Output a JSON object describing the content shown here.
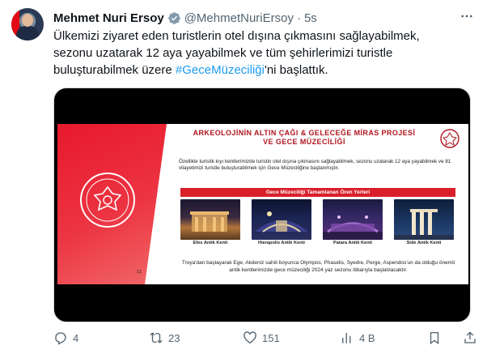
{
  "tweet": {
    "author_name": "Mehmet Nuri Ersoy",
    "handle": "@MehmetNuriErsoy",
    "separator": "·",
    "time": "5s",
    "more_icon": "more-horizontal-icon",
    "text_lines": [
      "Ülkemizi ziyaret eden turistlerin otel dışına çıkmasını sağlayabilmek,",
      "sezonu uzatarak 12 aya yayabilmek ve tüm şehirlerimizi turistle",
      "buluşturabilmek üzere "
    ],
    "hashtag": "#GeceMüzeciliği",
    "text_tail": "'ni başlattık."
  },
  "slide": {
    "title_line1": "ARKEOLOJİNİN ALTIN ÇAĞI & GELECEĞE MİRAS PROJESİ",
    "title_line2": "VE GECE MÜZECİLİĞİ",
    "paragraph": "Özellikle turistik kıyı kentlerimizde turistin otel dışına çıkmasını sağlayabilmek, sezonu uzatarak 12 aya yayabilmek ve 81 vilayetimizi turistle buluşturabilmek için Gece Müzeciliğine başlanmıştır.",
    "bar_label": "Gece Müzeciliği Tamamlanan Ören Yerleri",
    "sites": [
      {
        "caption": "Efes Antik Kenti"
      },
      {
        "caption": "Hierapolis Antik Kenti"
      },
      {
        "caption": "Patara Antik Kenti"
      },
      {
        "caption": "Side Antik Kenti"
      }
    ],
    "footer": "Troya'dan başlayarak Ege, Akdeniz sahili boyunca Olympos, Phaselis, Syedre, Perge, Aspendos'un da olduğu önemli antik kentlerimizde gece müzeciliği 2024 yaz sezonu itibarıyla başlatılacaktır.",
    "page_number": "11"
  },
  "actions": {
    "reply_count": "4",
    "repost_count": "23",
    "like_count": "151",
    "views_count": "4 B"
  },
  "colors": {
    "accent": "#1d9bf0",
    "muted": "#536471",
    "slide_red": "#e8192c"
  }
}
